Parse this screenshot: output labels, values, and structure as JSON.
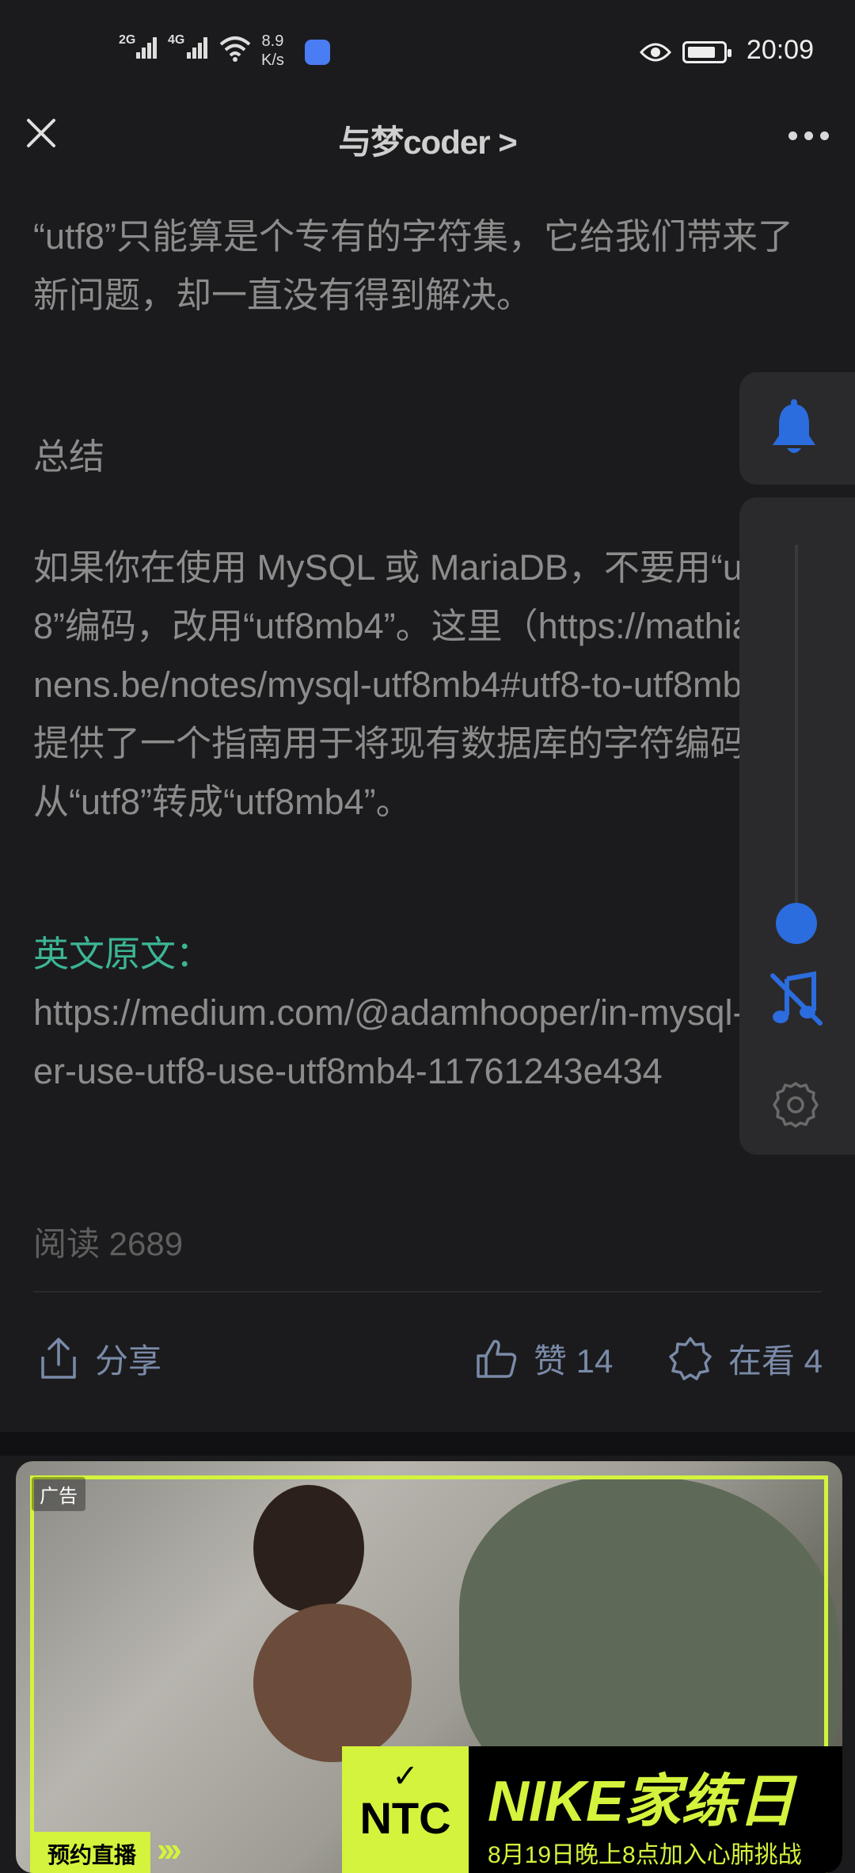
{
  "status_bar": {
    "sim1": "2G",
    "sim2": "4G",
    "speed_value": "8.9",
    "speed_unit": "K/s",
    "time": "20:09",
    "battery_level": 0.8
  },
  "header": {
    "title": "与梦coder >"
  },
  "article": {
    "paragraph1": "“utf8”只能算是个专有的字符集，它给我们带来了新问题，却一直没有得到解决。",
    "section_title": "总结",
    "paragraph2": "如果你在使用 MySQL 或 MariaDB，不要用“utf8”编码，改用“utf8mb4”。这里（https://mathiasbynens.be/notes/mysql-utf8mb4#utf8-to-utf8mb4）提供了一个指南用于将现有数据库的字符编码从“utf8”转成“utf8mb4”。",
    "source_label": "英文原文：",
    "source_url": "https://medium.com/@adamhooper/in-mysql-never-use-utf8-use-utf8mb4-11761243e434",
    "reads_label": "阅读 2689"
  },
  "actions": {
    "share": "分享",
    "like": "赞 14",
    "wow": "在看 4"
  },
  "ad": {
    "tag": "广告",
    "brand_short": "NTC",
    "headline": "NIKE家练日",
    "subline": "8月19日晚上8点加入心肺挑战",
    "live_label": "预约直播",
    "arrows": "›››"
  },
  "colors": {
    "background": "#1b1b1d",
    "accent_green": "#3cb595",
    "accent_blue": "#2b6cde",
    "ad_lime": "#d3f33c"
  },
  "icons": [
    "close-icon",
    "more-icon",
    "bell-icon",
    "music-off-icon",
    "gear-icon",
    "share-icon",
    "thumb-up-icon",
    "wow-icon",
    "eye-icon",
    "battery-icon",
    "wifi-icon"
  ]
}
